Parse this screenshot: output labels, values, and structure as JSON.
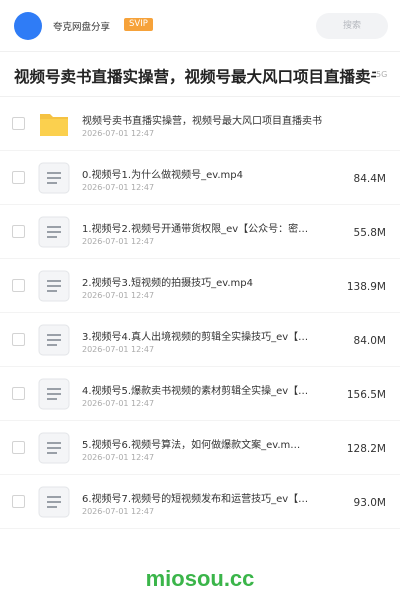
{
  "header": {
    "app_name": "夸克网盘分享",
    "badge": "SVIP",
    "search_placeholder": "搜索",
    "accent_color": "#2f7cf6",
    "badge_color": "#f6a23a"
  },
  "share": {
    "title": "视频号卖书直播实操营，视频号最大风口项目直播卖书",
    "total_size_fragment": "5G"
  },
  "files": [
    {
      "type": "folder",
      "icon": "folder-icon",
      "name": "视频号卖书直播实操营，视频号最大风口项目直播卖书",
      "date": "2026-07-01 12:47",
      "size": ""
    },
    {
      "type": "file",
      "icon": "document-icon",
      "name": "0.视频号1.为什么做视频号_ev.mp4",
      "date": "2026-07-01 12:47",
      "size": "84.4M"
    },
    {
      "type": "file",
      "icon": "document-icon",
      "name": "1.视频号2.视频号开通带货权限_ev【公众号：密…",
      "date": "2026-07-01 12:47",
      "size": "55.8M"
    },
    {
      "type": "file",
      "icon": "document-icon",
      "name": "2.视频号3.短视频的拍摄技巧_ev.mp4",
      "date": "2026-07-01 12:47",
      "size": "138.9M"
    },
    {
      "type": "file",
      "icon": "document-icon",
      "name": "3.视频号4.真人出境视频的剪辑全实操技巧_ev【…",
      "date": "2026-07-01 12:47",
      "size": "84.0M"
    },
    {
      "type": "file",
      "icon": "document-icon",
      "name": "4.视频号5.爆款卖书视频的素材剪辑全实操_ev【…",
      "date": "2026-07-01 12:47",
      "size": "156.5M"
    },
    {
      "type": "file",
      "icon": "document-icon",
      "name": "5.视频号6.视频号算法，如何做爆款文案_ev.m…",
      "date": "2026-07-01 12:47",
      "size": "128.2M"
    },
    {
      "type": "file",
      "icon": "document-icon",
      "name": "6.视频号7.视频号的短视频发布和运营技巧_ev【…",
      "date": "2026-07-01 12:47",
      "size": "93.0M"
    }
  ],
  "watermark": "miosou.cc"
}
